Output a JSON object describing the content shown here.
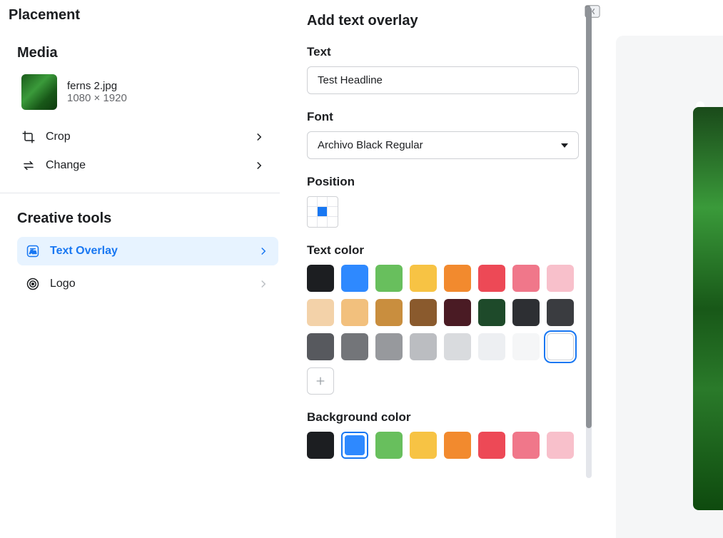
{
  "page_title": "Placement",
  "media": {
    "title": "Media",
    "filename": "ferns 2.jpg",
    "dimensions": "1080 × 1920",
    "actions": {
      "crop": "Crop",
      "change": "Change"
    }
  },
  "creative_tools": {
    "title": "Creative tools",
    "items": [
      {
        "label": "Text Overlay",
        "icon": "text-overlay-icon",
        "active": true
      },
      {
        "label": "Logo",
        "icon": "logo-icon",
        "active": false
      }
    ]
  },
  "overlay_panel": {
    "title": "Add text overlay",
    "text_label": "Text",
    "text_value": "Test Headline",
    "font_label": "Font",
    "font_value": "Archivo Black Regular",
    "position_label": "Position",
    "position_index": 4,
    "text_color_label": "Text color",
    "text_colors": [
      "#1c1e21",
      "#2e89ff",
      "#68bf5d",
      "#f7c344",
      "#f28a2e",
      "#ed4956",
      "#f0778a",
      "#f8c0cb",
      "#f3d2a9",
      "#f2c07d",
      "#c98e3e",
      "#8a5a2d",
      "#4a1b24",
      "#1e4a2a",
      "#2d2f33",
      "#3a3c40",
      "#57595e",
      "#737579",
      "#97999d",
      "#bbbdc1",
      "#d9dbde",
      "#edeff2",
      "#f5f6f7",
      "#ffffff"
    ],
    "text_color_selected_index": 23,
    "background_color_label": "Background color",
    "background_colors": [
      "#1c1e21",
      "#2e89ff",
      "#68bf5d",
      "#f7c344",
      "#f28a2e",
      "#ed4956",
      "#f0778a",
      "#f8c0cb"
    ],
    "background_color_selected_index": 1
  }
}
